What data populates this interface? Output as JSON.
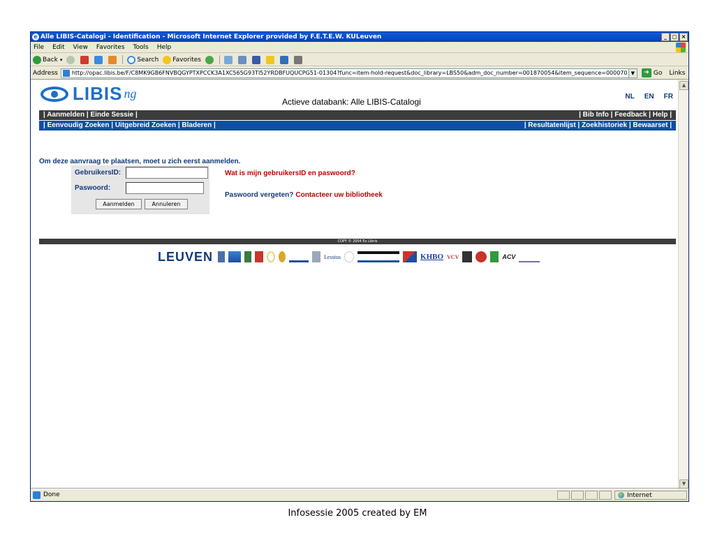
{
  "window": {
    "title": "Alle LIBIS-Catalogi - Identification - Microsoft Internet Explorer provided by F.E.T.E.W. KULeuven",
    "controls": [
      "_",
      "×"
    ]
  },
  "menu": {
    "items": [
      "File",
      "Edit",
      "View",
      "Favorites",
      "Tools",
      "Help"
    ]
  },
  "toolbar": {
    "back": "Back",
    "search": "Search",
    "favorites": "Favorites"
  },
  "address": {
    "label": "Address",
    "url": "http://opac.libis.be/F/C8MK9GB6FNVBQGYPTXPCCK3A1XC565G93TI52YRDBFUQUCPG51-01304?func=item-hold-request&doc_library=LBS50&adm_doc_number=001870054&item_sequence=000070",
    "go": "Go",
    "links": "Links"
  },
  "page": {
    "logo_text": "LIBIS",
    "logo_suffix": "ng",
    "db_title": "Actieve databank: Alle LIBIS-Catalogi",
    "languages": [
      "NL",
      "EN",
      "FR"
    ],
    "nav1_left": "| Aanmelden | Einde Sessie |",
    "nav1_right": "| Bib Info | Feedback | Help |",
    "nav2_left": "| Eenvoudig Zoeken | Uitgebreid Zoeken | Bladeren |",
    "nav2_right": "| Resultatenlijst | Zoekhistoriek | Bewaarset |",
    "intro": "Om deze aanvraag te plaatsen, moet u zich eerst aanmelden.",
    "login": {
      "user_label": "GebruikersID:",
      "user_value": "",
      "password_label": "Paswoord:",
      "password_value": "",
      "submit": "Aanmelden",
      "cancel": "Annuleren"
    },
    "help_link": "Wat is mijn gebruikersID en paswoord?",
    "forgot_question": "Paswoord vergeten?",
    "forgot_link": "Contacteer uw bibliotheek",
    "copyright": "COPY © 2004 Ex Libris",
    "partners": {
      "leuven": "LEUVEN",
      "kdc": "KDC",
      "lessius": "Lessius",
      "khbo": "KHBO",
      "vcv": "VCV",
      "acv": "ACV"
    }
  },
  "status": {
    "text": "Done",
    "zone": "Internet"
  },
  "caption": "Infosessie 2005  created by EM",
  "colors": {
    "nav_dark": "#3c3c3c",
    "nav_blue": "#0f4fa0",
    "brand_blue": "#1f6fc5",
    "label_blue": "#123a78",
    "link_red": "#c00000"
  }
}
